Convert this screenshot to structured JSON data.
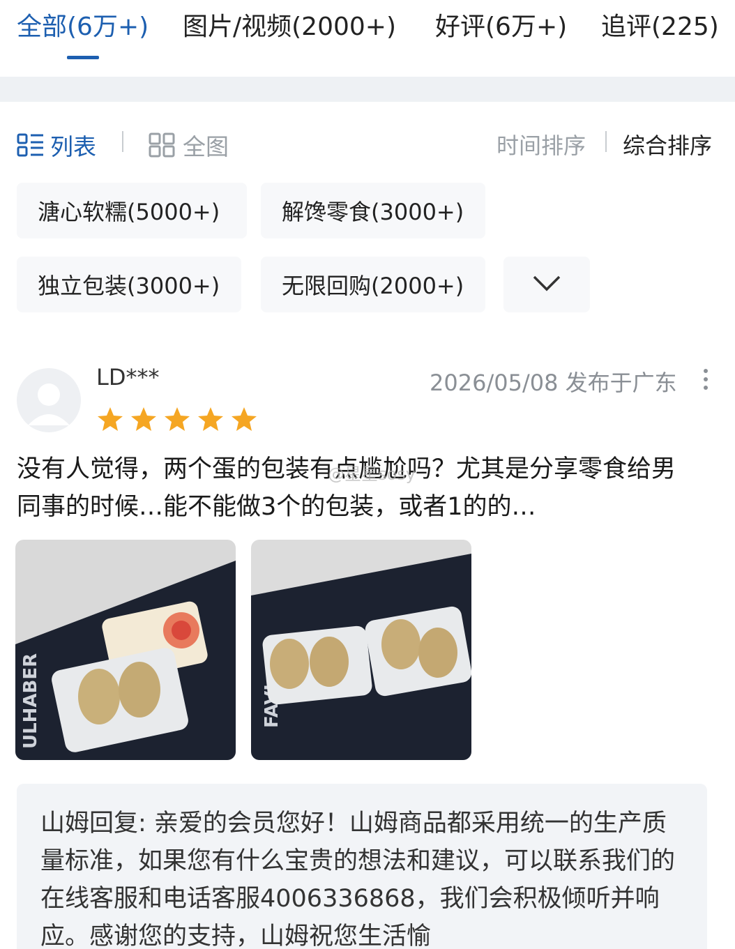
{
  "tabs": {
    "all": "全部(6万+)",
    "media": "图片/视频(2000+)",
    "positive": "好评(6万+)",
    "followup": "追评(225)"
  },
  "colors": {
    "accent": "#1d5fb0",
    "star": "#f5a623",
    "muted": "#9aa0a6"
  },
  "view": {
    "list_label": "列表",
    "grid_label": "全图",
    "list_icon": "list-icon",
    "grid_icon": "grid-icon"
  },
  "sort": {
    "time": "时间排序",
    "overall": "综合排序"
  },
  "tags": [
    "溏心软糯(5000+)",
    "解馋零食(3000+)",
    "独立包装(3000+)",
    "无限回购(2000+)"
  ],
  "review": {
    "username": "LD***",
    "rating": 5,
    "meta": "2026/05/08 发布于广东",
    "text": "没有人觉得，两个蛋的包装有点尴尬吗？尤其是分享零食给男同事的时候…能不能做3个的包装，或者1的的…",
    "watermark": "@星星sosy",
    "photos": [
      "photo-1",
      "photo-2"
    ]
  },
  "reply": {
    "text": "山姆回复: 亲爱的会员您好！山姆商品都采用统一的生产质量标准，如果您有什么宝贵的想法和建议，可以联系我们的在线客服和电话客服4006336868，我们会积极倾听并响应。感谢您的支持，山姆祝您生活愉"
  }
}
